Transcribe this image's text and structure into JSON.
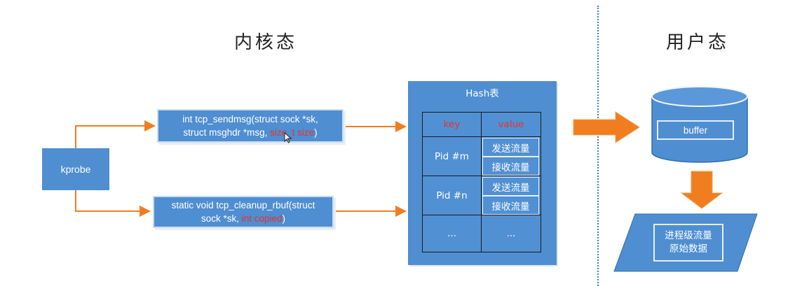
{
  "titles": {
    "kernel": "内核态",
    "user": "用户态"
  },
  "kprobe": {
    "label": "kprobe"
  },
  "functions": {
    "sendmsg": {
      "line1": "int tcp_sendmsg(struct sock *sk,",
      "line2_a": "struct msghdr *msg, ",
      "line2_b": "size_t size",
      "line2_c": ")"
    },
    "cleanup": {
      "line1": "static void tcp_cleanup_rbuf(struct",
      "line2_a": "sock *sk, ",
      "line2_b": "int copied",
      "line2_c": ")"
    }
  },
  "hash_table": {
    "title": "Hash表",
    "header": {
      "key": "key",
      "value": "value"
    },
    "rows": [
      {
        "key": "Pid #m",
        "values": [
          "发送流量",
          "接收流量"
        ]
      },
      {
        "key": "Pid #n",
        "values": [
          "发送流量",
          "接收流量"
        ]
      },
      {
        "key": "...",
        "values": [
          "..."
        ]
      }
    ]
  },
  "buffer": {
    "label": "buffer"
  },
  "output": {
    "line1": "进程级流量",
    "line2": "原始数据"
  },
  "colors": {
    "box_blue": "#4f8ed1",
    "arrow_orange": "#f07d1f",
    "highlight_red": "#e8322a",
    "divider": "#3b7fc6"
  }
}
